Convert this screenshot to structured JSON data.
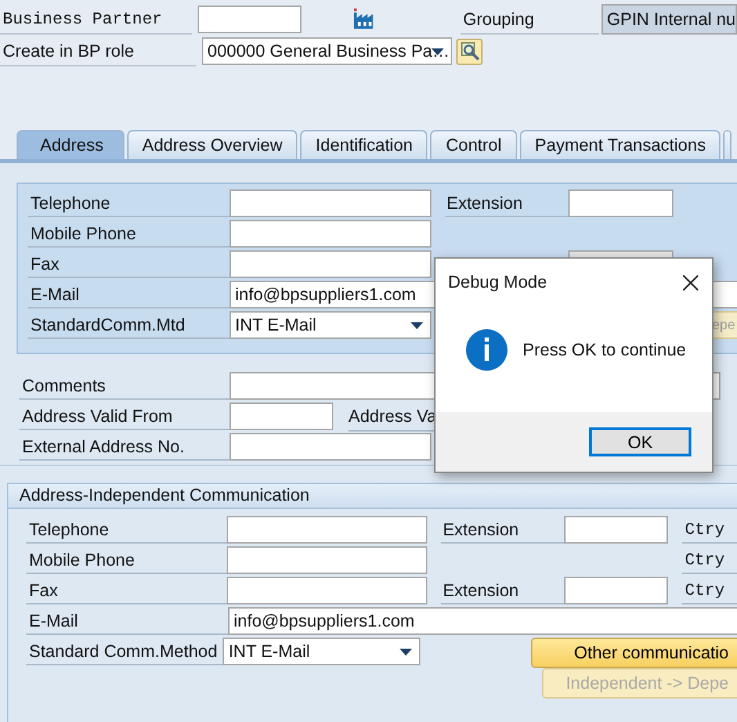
{
  "header_fields": [
    {
      "kind": "input",
      "label": "Business Partner"
    },
    {
      "kind": "dropdown",
      "label": "Create in BP role",
      "value": "000000 General Business Pa…"
    }
  ],
  "grouping": {
    "label": "Grouping",
    "value": "GPIN Internal nu"
  },
  "tabs": [
    {
      "label": "Address",
      "selected": true
    },
    {
      "label": "Address Overview",
      "selected": false
    },
    {
      "label": "Identification",
      "selected": false
    },
    {
      "label": "Control",
      "selected": false
    },
    {
      "label": "Payment Transactions",
      "selected": false
    }
  ],
  "address_communication": {
    "rows": [
      {
        "kind": "input",
        "label": "Telephone",
        "extension": {
          "label": "Extension",
          "disabled": false
        }
      },
      {
        "kind": "input",
        "label": "Mobile Phone"
      },
      {
        "kind": "input",
        "label": "Fax",
        "extension": {
          "disabled": true
        }
      },
      {
        "kind": "wide",
        "label": "E-Mail",
        "value": "info@bpsuppliers1.com"
      },
      {
        "kind": "dropdown",
        "label": "StandardComm.Mtd",
        "value": "INT E-Mail",
        "button": {
          "label": "epe",
          "disabled": true
        }
      }
    ]
  },
  "address_fields": [
    {
      "kind": "comment",
      "label": "Comments"
    },
    {
      "kind": "date",
      "label": "Address Valid From",
      "second_label": "Address Va"
    },
    {
      "kind": "input",
      "label": "External Address No."
    }
  ],
  "independent_section": {
    "title": "Address-Independent Communication",
    "rows": [
      {
        "kind": "input",
        "label": "Telephone",
        "extension": {
          "label": "Extension",
          "disabled": false
        },
        "ctry": "Ctry"
      },
      {
        "kind": "input",
        "label": "Mobile Phone",
        "ctry": "Ctry"
      },
      {
        "kind": "input",
        "label": "Fax",
        "extension": {
          "label": "Extension",
          "disabled": false
        },
        "ctry": "Ctry"
      },
      {
        "kind": "wide",
        "label": "E-Mail",
        "value": "info@bpsuppliers1.com"
      },
      {
        "kind": "dropdown",
        "label": "Standard Comm.Method",
        "value": "INT E-Mail",
        "button": {
          "label": "Other communicatio",
          "disabled": false
        }
      },
      {
        "kind": "button_only",
        "button": {
          "label": "Independent -> Depe",
          "disabled": true
        }
      }
    ]
  },
  "dialog": {
    "title": "Debug Mode",
    "message": "Press OK to continue",
    "buttons": [
      {
        "label": "OK",
        "default": true
      }
    ]
  }
}
